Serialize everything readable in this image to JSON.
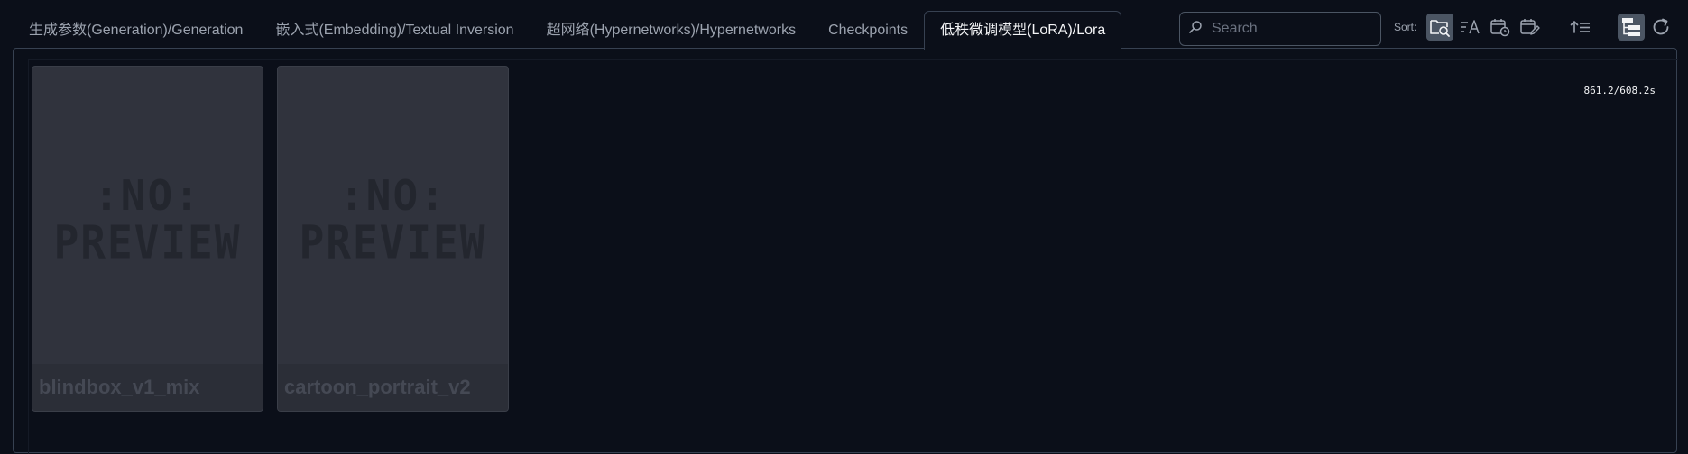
{
  "tabs": [
    {
      "label": "生成参数(Generation)/Generation",
      "active": false
    },
    {
      "label": "嵌入式(Embedding)/Textual Inversion",
      "active": false
    },
    {
      "label": "超网络(Hypernetworks)/Hypernetworks",
      "active": false
    },
    {
      "label": "Checkpoints",
      "active": false
    },
    {
      "label": "低秩微调模型(LoRA)/Lora",
      "active": true
    }
  ],
  "search": {
    "placeholder": "Search",
    "value": ""
  },
  "sort": {
    "label": "Sort:",
    "options": [
      {
        "icon": "sort-by-path-icon",
        "selected": true
      },
      {
        "icon": "sort-by-name-icon",
        "selected": false
      },
      {
        "icon": "sort-by-date-created-icon",
        "selected": false
      },
      {
        "icon": "sort-by-date-modified-icon",
        "selected": false
      }
    ],
    "direction_icon": "sort-ascending-icon"
  },
  "view": {
    "tree_view_icon": "tree-view-icon",
    "refresh_icon": "refresh-icon"
  },
  "timing": "861.2/608.2s",
  "cards": [
    {
      "name": "blindbox_v1_mix",
      "preview_line1": ":NO:",
      "preview_line2": "PREVIEW"
    },
    {
      "name": "cartoon_portrait_v2",
      "preview_line1": ":NO:",
      "preview_line2": "PREVIEW"
    }
  ],
  "colors": {
    "background": "#0b0f19",
    "card": "#30333d",
    "selected_button": "#4b5563",
    "border": "#374151"
  }
}
